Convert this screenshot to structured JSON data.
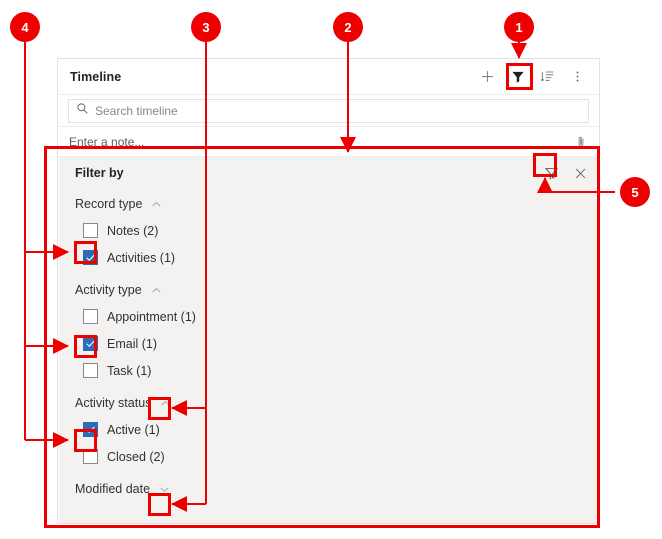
{
  "card": {
    "title": "Timeline",
    "header_icons": [
      {
        "name": "add-icon",
        "glyph": "+"
      },
      {
        "name": "filter-icon",
        "glyph": "funnel-filled"
      },
      {
        "name": "sort-icon",
        "glyph": "sort-list"
      },
      {
        "name": "more-commands-icon",
        "glyph": "ellipsis-vertical"
      }
    ],
    "search": {
      "icon": "search-icon",
      "placeholder": "Search timeline",
      "value": ""
    },
    "note": {
      "placeholder": "Enter a note...",
      "value": "",
      "attach_icon": "paperclip-icon"
    }
  },
  "filter_panel": {
    "title": "Filter by",
    "clear_filter_icon": "clear-filter-icon",
    "close_icon": "close-icon",
    "groups": [
      {
        "label": "Record type",
        "chevron": "chevron-up-icon",
        "expanded": true,
        "options": [
          {
            "label": "Notes (2)",
            "checked": false
          },
          {
            "label": "Activities (1)",
            "checked": true
          }
        ]
      },
      {
        "label": "Activity type",
        "chevron": "chevron-up-icon",
        "expanded": true,
        "options": [
          {
            "label": "Appointment (1)",
            "checked": false
          },
          {
            "label": "Email (1)",
            "checked": true
          },
          {
            "label": "Task (1)",
            "checked": false
          }
        ]
      },
      {
        "label": "Activity status",
        "chevron": "chevron-up-icon",
        "expanded": true,
        "options": [
          {
            "label": "Active (1)",
            "checked": true
          },
          {
            "label": "Closed (2)",
            "checked": false
          }
        ]
      },
      {
        "label": "Modified date",
        "chevron": "chevron-down-icon",
        "expanded": false,
        "options": []
      }
    ]
  },
  "annotations": {
    "accent_color": "#ee0000",
    "callouts": [
      {
        "number": "1",
        "target": "timeline-filter-toolbar-button"
      },
      {
        "number": "2",
        "target": "filter-panel"
      },
      {
        "number": "3",
        "target": "group-expand-collapse-chevrons"
      },
      {
        "number": "4",
        "target": "checked-filter-checkboxes"
      },
      {
        "number": "5",
        "target": "clear-filter-button"
      }
    ]
  }
}
